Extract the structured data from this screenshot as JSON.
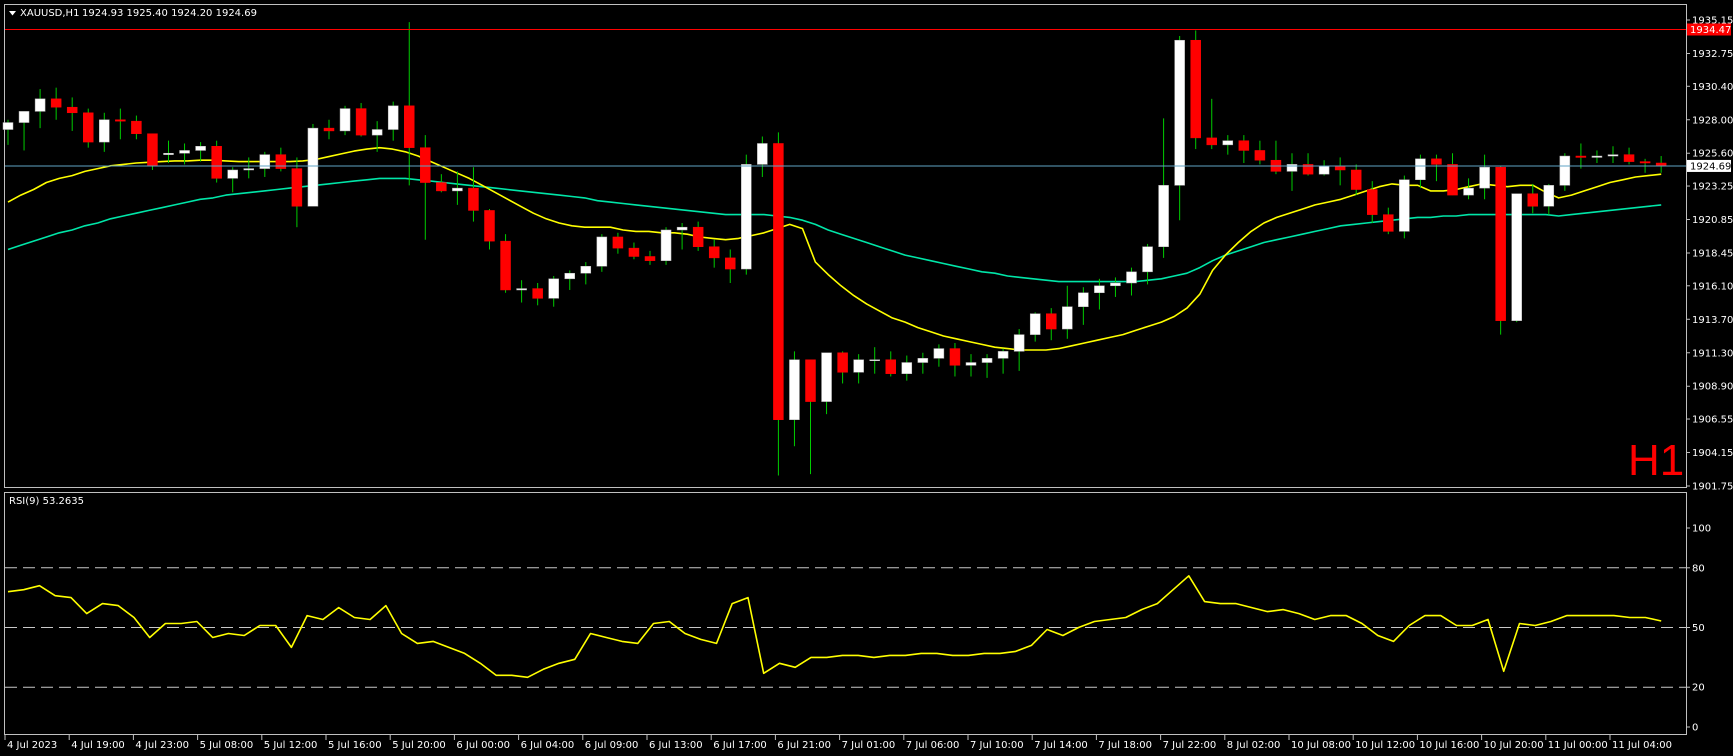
{
  "header": {
    "menu_arrow_icon": "triangle-down-icon",
    "symbol": "XAUUSD,H1",
    "ohlc": "1924.93 1925.40 1924.20 1924.69"
  },
  "timeframe_watermark": "H1",
  "price_axis": {
    "ticks": [
      "1935.15",
      "1932.75",
      "1930.40",
      "1928.00",
      "1925.60",
      "1923.25",
      "1920.85",
      "1918.45",
      "1916.10",
      "1913.70",
      "1911.30",
      "1908.90",
      "1906.55",
      "1904.15",
      "1901.75"
    ],
    "current_price": "1924.69",
    "current_line_price": 1924.69,
    "high_line_price": "1934.47"
  },
  "time_axis": {
    "labels": [
      "4 Jul 2023",
      "4 Jul 19:00",
      "4 Jul 23:00",
      "5 Jul 08:00",
      "5 Jul 12:00",
      "5 Jul 16:00",
      "5 Jul 20:00",
      "6 Jul 00:00",
      "6 Jul 04:00",
      "6 Jul 09:00",
      "6 Jul 13:00",
      "6 Jul 17:00",
      "6 Jul 21:00",
      "7 Jul 01:00",
      "7 Jul 06:00",
      "7 Jul 10:00",
      "7 Jul 14:00",
      "7 Jul 18:00",
      "7 Jul 22:00",
      "8 Jul 02:00",
      "10 Jul 08:00",
      "10 Jul 12:00",
      "10 Jul 16:00",
      "10 Jul 20:00",
      "11 Jul 00:00",
      "11 Jul 04:00"
    ]
  },
  "rsi": {
    "label": "RSI(9) 53.2635",
    "axis_ticks": [
      "100",
      "80",
      "50",
      "20",
      "0"
    ],
    "levels": [
      80,
      50,
      20
    ]
  },
  "colors": {
    "bull_candle": "#ffffff",
    "bear_candle": "#ff0000",
    "wick": "#00cc00",
    "ma_fast": "#ffff00",
    "ma_slow": "#00e6a8",
    "rsi_line": "#ffff00",
    "current_line": "#5fa3c4",
    "high_line": "#ff0000"
  },
  "chart_data": {
    "type": "candlestick",
    "candles": [
      [
        1927.3,
        1928.0,
        1926.2,
        1927.8
      ],
      [
        1927.8,
        1928.6,
        1925.8,
        1928.6
      ],
      [
        1928.6,
        1930.2,
        1927.4,
        1929.5
      ],
      [
        1929.5,
        1930.3,
        1928.0,
        1928.9
      ],
      [
        1928.9,
        1929.6,
        1927.2,
        1928.5
      ],
      [
        1928.5,
        1928.8,
        1926.0,
        1926.4
      ],
      [
        1926.4,
        1928.5,
        1925.7,
        1928.0
      ],
      [
        1928.0,
        1928.8,
        1926.6,
        1927.9
      ],
      [
        1927.9,
        1928.3,
        1926.6,
        1927.0
      ],
      [
        1927.0,
        1927.0,
        1924.4,
        1924.7
      ],
      [
        1925.5,
        1926.5,
        1924.9,
        1925.6
      ],
      [
        1925.6,
        1926.3,
        1924.8,
        1925.8
      ],
      [
        1925.8,
        1926.4,
        1925.0,
        1926.1
      ],
      [
        1926.1,
        1926.5,
        1923.5,
        1923.8
      ],
      [
        1923.8,
        1924.6,
        1922.8,
        1924.4
      ],
      [
        1924.4,
        1925.3,
        1923.8,
        1924.5
      ],
      [
        1924.5,
        1925.7,
        1923.9,
        1925.5
      ],
      [
        1925.5,
        1926.0,
        1924.3,
        1924.5
      ],
      [
        1924.5,
        1925.3,
        1920.3,
        1921.8
      ],
      [
        1921.8,
        1927.7,
        1921.8,
        1927.4
      ],
      [
        1927.4,
        1928.0,
        1926.6,
        1927.2
      ],
      [
        1927.2,
        1929.0,
        1926.9,
        1928.8
      ],
      [
        1928.8,
        1929.2,
        1926.8,
        1926.9
      ],
      [
        1926.9,
        1927.9,
        1925.7,
        1927.3
      ],
      [
        1927.3,
        1929.3,
        1926.5,
        1929.0
      ],
      [
        1929.0,
        1935.0,
        1923.3,
        1926.0
      ],
      [
        1926.0,
        1926.9,
        1919.4,
        1923.5
      ],
      [
        1923.5,
        1924.1,
        1922.8,
        1922.9
      ],
      [
        1922.9,
        1924.3,
        1921.9,
        1923.1
      ],
      [
        1923.1,
        1924.6,
        1920.7,
        1921.5
      ],
      [
        1921.5,
        1921.6,
        1918.7,
        1919.3
      ],
      [
        1919.3,
        1919.8,
        1915.6,
        1915.8
      ],
      [
        1915.8,
        1916.5,
        1914.9,
        1915.9
      ],
      [
        1915.9,
        1916.3,
        1914.7,
        1915.2
      ],
      [
        1915.2,
        1916.8,
        1914.6,
        1916.6
      ],
      [
        1916.6,
        1917.2,
        1915.8,
        1917.0
      ],
      [
        1917.0,
        1917.8,
        1916.2,
        1917.5
      ],
      [
        1917.5,
        1919.8,
        1917.1,
        1919.6
      ],
      [
        1919.6,
        1919.9,
        1918.4,
        1918.8
      ],
      [
        1918.8,
        1919.2,
        1918.0,
        1918.2
      ],
      [
        1918.2,
        1918.6,
        1917.6,
        1917.9
      ],
      [
        1917.9,
        1920.3,
        1917.6,
        1920.1
      ],
      [
        1920.1,
        1920.6,
        1918.7,
        1920.3
      ],
      [
        1920.3,
        1920.7,
        1918.6,
        1918.9
      ],
      [
        1918.9,
        1919.4,
        1917.4,
        1918.1
      ],
      [
        1918.1,
        1918.7,
        1916.3,
        1917.3
      ],
      [
        1917.3,
        1925.5,
        1916.9,
        1924.8
      ],
      [
        1924.8,
        1926.8,
        1923.9,
        1926.3
      ],
      [
        1926.3,
        1927.1,
        1902.5,
        1906.5
      ],
      [
        1906.5,
        1911.4,
        1904.6,
        1910.8
      ],
      [
        1910.8,
        1910.8,
        1902.6,
        1907.8
      ],
      [
        1907.8,
        1910.9,
        1906.9,
        1911.3
      ],
      [
        1911.3,
        1911.4,
        1909.1,
        1909.9
      ],
      [
        1909.9,
        1911.2,
        1909.1,
        1910.8
      ],
      [
        1910.8,
        1911.7,
        1909.8,
        1910.8
      ],
      [
        1910.8,
        1911.4,
        1909.6,
        1909.8
      ],
      [
        1909.8,
        1911.1,
        1909.3,
        1910.6
      ],
      [
        1910.6,
        1911.3,
        1909.8,
        1910.9
      ],
      [
        1910.9,
        1911.9,
        1910.3,
        1911.6
      ],
      [
        1911.6,
        1912.0,
        1909.6,
        1910.4
      ],
      [
        1910.4,
        1911.2,
        1909.6,
        1910.6
      ],
      [
        1910.6,
        1911.2,
        1909.5,
        1910.9
      ],
      [
        1910.9,
        1911.6,
        1909.8,
        1911.4
      ],
      [
        1911.4,
        1913.0,
        1910.0,
        1912.6
      ],
      [
        1912.6,
        1914.2,
        1912.1,
        1914.1
      ],
      [
        1914.1,
        1914.5,
        1912.2,
        1913.0
      ],
      [
        1913.0,
        1916.1,
        1912.3,
        1914.6
      ],
      [
        1914.6,
        1916.0,
        1913.3,
        1915.6
      ],
      [
        1915.6,
        1916.6,
        1914.4,
        1916.1
      ],
      [
        1916.1,
        1916.7,
        1915.3,
        1916.3
      ],
      [
        1916.3,
        1917.4,
        1915.4,
        1917.1
      ],
      [
        1917.1,
        1919.1,
        1916.2,
        1918.9
      ],
      [
        1918.9,
        1928.1,
        1918.1,
        1923.3
      ],
      [
        1923.3,
        1934.0,
        1920.8,
        1933.7
      ],
      [
        1933.7,
        1934.4,
        1925.9,
        1926.7
      ],
      [
        1926.7,
        1929.5,
        1925.9,
        1926.2
      ],
      [
        1926.2,
        1926.9,
        1925.5,
        1926.5
      ],
      [
        1926.5,
        1926.9,
        1924.9,
        1925.8
      ],
      [
        1925.8,
        1926.5,
        1924.8,
        1925.1
      ],
      [
        1925.1,
        1926.5,
        1924.1,
        1924.3
      ],
      [
        1924.3,
        1925.6,
        1922.9,
        1924.8
      ],
      [
        1924.8,
        1925.6,
        1924.0,
        1924.1
      ],
      [
        1924.1,
        1925.1,
        1924.0,
        1924.7
      ],
      [
        1924.7,
        1925.3,
        1923.3,
        1924.4
      ],
      [
        1924.4,
        1924.8,
        1922.6,
        1923.0
      ],
      [
        1923.0,
        1923.6,
        1920.6,
        1921.2
      ],
      [
        1921.2,
        1921.7,
        1919.8,
        1920.0
      ],
      [
        1920.0,
        1924.0,
        1919.5,
        1923.7
      ],
      [
        1923.7,
        1925.5,
        1923.1,
        1925.2
      ],
      [
        1925.2,
        1925.5,
        1923.6,
        1924.8
      ],
      [
        1924.8,
        1925.6,
        1922.6,
        1922.6
      ],
      [
        1922.6,
        1923.8,
        1922.3,
        1923.1
      ],
      [
        1923.1,
        1925.5,
        1922.3,
        1924.6
      ],
      [
        1924.6,
        1924.7,
        1912.6,
        1913.6
      ],
      [
        1913.6,
        1922.7,
        1913.5,
        1922.7
      ],
      [
        1922.7,
        1923.4,
        1921.3,
        1921.8
      ],
      [
        1921.8,
        1923.4,
        1921.2,
        1923.3
      ],
      [
        1923.3,
        1925.6,
        1922.9,
        1925.4
      ],
      [
        1925.4,
        1926.3,
        1924.5,
        1925.3
      ],
      [
        1925.3,
        1925.8,
        1924.9,
        1925.4
      ],
      [
        1925.4,
        1926.1,
        1924.9,
        1925.5
      ],
      [
        1925.5,
        1926.0,
        1924.8,
        1925.0
      ],
      [
        1925.0,
        1925.2,
        1924.2,
        1924.9
      ],
      [
        1924.9,
        1925.4,
        1924.2,
        1924.7
      ]
    ],
    "ma_fast": [
      1922.1,
      1922.6,
      1923.0,
      1923.5,
      1923.8,
      1924.0,
      1924.3,
      1924.5,
      1924.7,
      1924.8,
      1924.9,
      1924.95,
      1925.0,
      1925.05,
      1925.05,
      1925.1,
      1925.1,
      1925.05,
      1925.0,
      1925.0,
      1925.0,
      1925.0,
      1925.0,
      1925.05,
      1925.15,
      1925.35,
      1925.55,
      1925.75,
      1925.9,
      1926.0,
      1925.9,
      1925.7,
      1925.4,
      1925.0,
      1924.6,
      1924.2,
      1923.8,
      1923.3,
      1922.8,
      1922.3,
      1921.8,
      1921.3,
      1920.9,
      1920.6,
      1920.4,
      1920.3,
      1920.3,
      1920.3,
      1920.1,
      1920.0,
      1920.0,
      1919.9,
      1919.9,
      1919.8,
      1919.6,
      1919.5,
      1919.4,
      1919.5,
      1919.7,
      1919.9,
      1920.2,
      1920.5,
      1920.2,
      1917.8,
      1916.9,
      1916.1,
      1915.4,
      1914.8,
      1914.3,
      1913.8,
      1913.5,
      1913.1,
      1912.8,
      1912.5,
      1912.3,
      1912.1,
      1911.9,
      1911.7,
      1911.6,
      1911.5,
      1911.5,
      1911.5,
      1911.6,
      1911.8,
      1912.0,
      1912.2,
      1912.4,
      1912.6,
      1912.9,
      1913.2,
      1913.5,
      1913.9,
      1914.5,
      1915.5,
      1917.2,
      1918.3,
      1919.2,
      1920.0,
      1920.6,
      1921.0,
      1921.3,
      1921.6,
      1921.9,
      1922.1,
      1922.3,
      1922.6,
      1922.9,
      1923.2,
      1923.4,
      1923.3,
      1923.3,
      1922.9,
      1922.9,
      1923.0,
      1923.2,
      1923.4,
      1923.3,
      1923.2,
      1923.3,
      1923.3,
      1922.8,
      1922.4,
      1922.6,
      1922.9,
      1923.2,
      1923.5,
      1923.7,
      1923.9,
      1924.0,
      1924.1
    ],
    "ma_slow": [
      1918.7,
      1919.0,
      1919.3,
      1919.6,
      1919.9,
      1920.1,
      1920.4,
      1920.6,
      1920.9,
      1921.1,
      1921.3,
      1921.5,
      1921.7,
      1921.9,
      1922.1,
      1922.3,
      1922.4,
      1922.6,
      1922.7,
      1922.8,
      1922.9,
      1923.0,
      1923.1,
      1923.2,
      1923.3,
      1923.4,
      1923.5,
      1923.6,
      1923.7,
      1923.8,
      1923.8,
      1923.8,
      1923.7,
      1923.6,
      1923.5,
      1923.4,
      1923.3,
      1923.2,
      1923.1,
      1923.0,
      1922.9,
      1922.8,
      1922.7,
      1922.6,
      1922.5,
      1922.4,
      1922.2,
      1922.1,
      1922.0,
      1921.9,
      1921.8,
      1921.7,
      1921.6,
      1921.5,
      1921.4,
      1921.3,
      1921.2,
      1921.2,
      1921.2,
      1921.2,
      1921.1,
      1921.0,
      1920.8,
      1920.5,
      1920.1,
      1919.8,
      1919.5,
      1919.2,
      1918.9,
      1918.6,
      1918.3,
      1918.1,
      1917.9,
      1917.7,
      1917.5,
      1917.3,
      1917.1,
      1917.0,
      1916.8,
      1916.7,
      1916.6,
      1916.5,
      1916.4,
      1916.4,
      1916.4,
      1916.4,
      1916.4,
      1916.4,
      1916.4,
      1916.5,
      1916.6,
      1916.8,
      1917.0,
      1917.4,
      1917.9,
      1918.3,
      1918.6,
      1918.9,
      1919.2,
      1919.4,
      1919.6,
      1919.8,
      1920.0,
      1920.2,
      1920.4,
      1920.5,
      1920.6,
      1920.7,
      1920.8,
      1920.9,
      1921.0,
      1921.0,
      1921.1,
      1921.1,
      1921.2,
      1921.2,
      1921.2,
      1921.2,
      1921.2,
      1921.2,
      1921.2,
      1921.1,
      1921.2,
      1921.3,
      1921.4,
      1921.5,
      1921.6,
      1921.7,
      1921.8,
      1921.9
    ],
    "rsi": [
      68,
      69,
      71,
      66,
      65,
      57,
      62,
      61,
      55,
      45,
      52,
      52,
      53,
      45,
      47,
      46,
      51,
      51,
      40,
      56,
      54,
      60,
      55,
      54,
      61,
      47,
      42,
      43,
      40,
      37,
      32,
      26,
      26,
      25,
      29,
      32,
      34,
      47,
      45,
      43,
      42,
      52,
      53,
      47,
      44,
      42,
      62,
      65,
      27,
      32,
      30,
      35,
      35,
      36,
      36,
      35,
      36,
      36,
      37,
      37,
      36,
      36,
      37,
      37,
      38,
      41,
      49,
      46,
      50,
      53,
      54,
      55,
      59,
      62,
      69,
      76,
      63,
      62,
      62,
      60,
      58,
      59,
      57,
      54,
      56,
      56,
      52,
      46,
      43,
      51,
      56,
      56,
      51,
      51,
      54,
      28,
      52,
      51,
      53,
      56,
      56,
      56,
      56,
      55,
      55,
      53.26
    ],
    "price_range": [
      1901.75,
      1935.15
    ],
    "rsi_range": [
      0,
      100
    ]
  }
}
